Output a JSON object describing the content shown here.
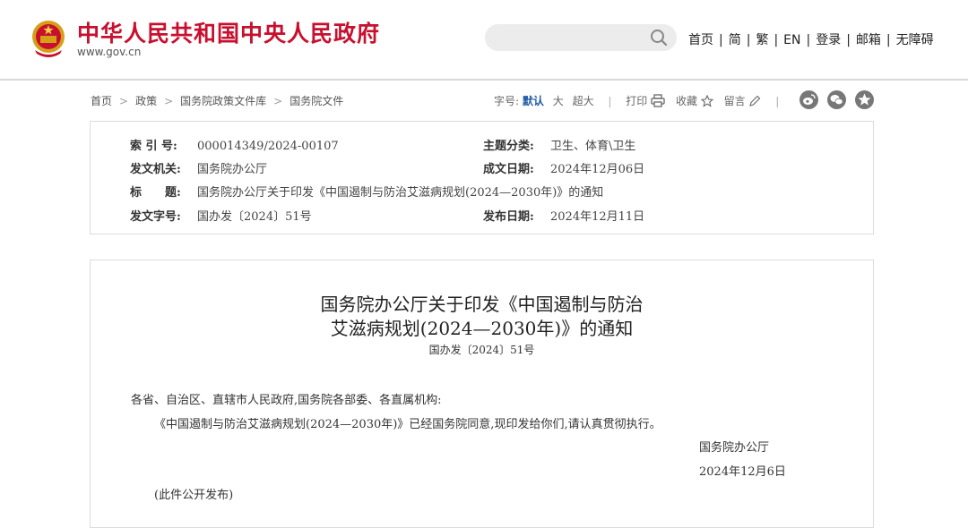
{
  "header": {
    "site_title": "中华人民共和国中央人民政府",
    "site_url": "www.gov.cn",
    "nav": [
      "首页",
      "简",
      "繁",
      "EN",
      "登录",
      "邮箱",
      "无障碍"
    ]
  },
  "breadcrumb": [
    "首页",
    "政策",
    "国务院政策文件库",
    "国务院文件"
  ],
  "tools": {
    "font_label": "字号:",
    "font_sizes": [
      "默认",
      "大",
      "超大"
    ],
    "print": "打印",
    "favorite": "收藏",
    "comment": "留言"
  },
  "meta": {
    "index_label": "索 引 号:",
    "index_value": "000014349/2024-00107",
    "category_label": "主题分类:",
    "category_value": "卫生、体育\\卫生",
    "issuer_label": "发文机关:",
    "issuer_value": "国务院办公厅",
    "written_date_label": "成文日期:",
    "written_date_value": "2024年12月06日",
    "title_label": "标　　题:",
    "title_value": "国务院办公厅关于印发《中国遏制与防治艾滋病规划(2024—2030年)》的通知",
    "doc_no_label": "发文字号:",
    "doc_no_value": "国办发〔2024〕51号",
    "publish_date_label": "发布日期:",
    "publish_date_value": "2024年12月11日"
  },
  "doc": {
    "title_line1": "国务院办公厅关于印发《中国遏制与防治",
    "title_line2": "艾滋病规划(2024—2030年)》的通知",
    "doc_number": "国办发〔2024〕51号",
    "salutation": "各省、自治区、直辖市人民政府,国务院各部委、各直属机构:",
    "body": "《中国遏制与防治艾滋病规划(2024—2030年)》已经国务院同意,现印发给你们,请认真贯彻执行。",
    "signer": "国务院办公厅",
    "date": "2024年12月6日",
    "note": "(此件公开发布)"
  }
}
